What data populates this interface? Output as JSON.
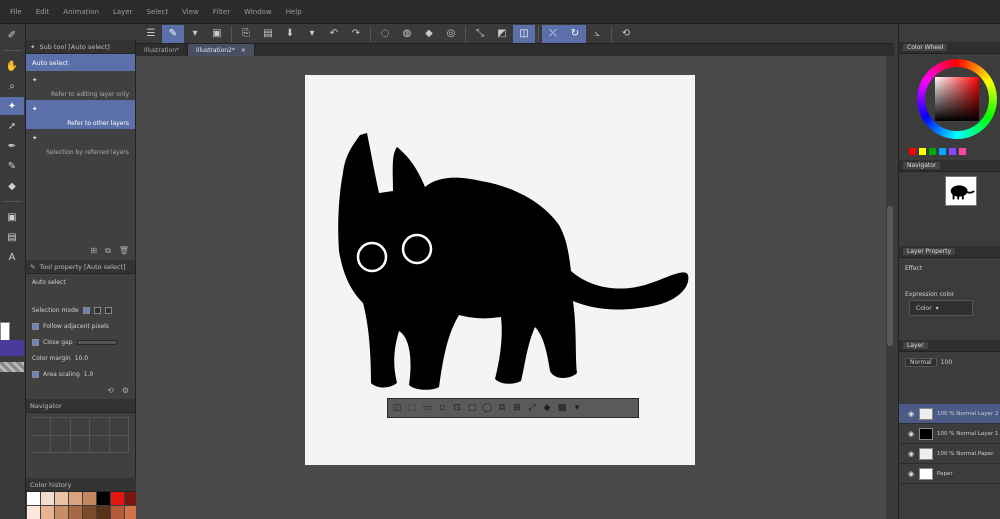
{
  "menu": [
    "File",
    "Edit",
    "Animation",
    "Layer",
    "Select",
    "View",
    "Filter",
    "Window",
    "Help"
  ],
  "command_bar": {
    "icons": [
      "menu-icon",
      "brush-mode-icon",
      "new-icon",
      "open-icon",
      "save-icon",
      "undo-icon",
      "redo-icon",
      "select-all-icon",
      "deselect-icon",
      "fill-icon",
      "transform-icon",
      "flip-icon",
      "ruler-icon",
      "layer-icon",
      "snap-icon",
      "grid-icon",
      "perspective-icon",
      "rotate-icon"
    ]
  },
  "tools": {
    "items": [
      "pen-icon",
      "hand-icon",
      "zoom-icon",
      "auto-select-icon",
      "move-icon",
      "brush-icon",
      "eraser-icon",
      "figure-icon",
      "text-icon"
    ],
    "active_index": 3
  },
  "left_panel": {
    "sub_tool_title": "Sub tool [Auto select]",
    "sub_tools": [
      {
        "label": "Auto select",
        "selected": true
      },
      {
        "label": "Refer to editing layer only",
        "selected": false
      },
      {
        "label": "Refer to other layers",
        "selected": true
      },
      {
        "label": "Selection by referred layers",
        "selected": false
      }
    ],
    "tool_property_title": "Tool property [Auto select]",
    "tool_property_subtitle": "Auto select",
    "properties": [
      {
        "label": "Selection mode",
        "checked": null
      },
      {
        "label": "Follow adjacent pixels",
        "checked": true
      },
      {
        "label": "Close gap",
        "checked": true
      },
      {
        "label": "Color margin",
        "value": "10.0"
      },
      {
        "label": "Area scaling",
        "checked": true,
        "value": "1.0"
      }
    ],
    "navigator_title": "Navigator",
    "color_history_title": "Color history",
    "swatch_colors": [
      "#ffffff",
      "#f1ddd0",
      "#e8c3a6",
      "#d8a47f",
      "#c4885e",
      "#000000",
      "#e0160f",
      "#7a1610",
      "#fde7dc",
      "#e9b291",
      "#c98d66",
      "#a56a45",
      "#7d4a2b",
      "#5a3219",
      "#b55b3a",
      "#d4734a"
    ]
  },
  "tabs": [
    {
      "label": "Illustration*",
      "active": false
    },
    {
      "label": "Illustration2*",
      "active": true
    }
  ],
  "canvas": {
    "paper_color": "#f4f4f4",
    "subject": "black-cat-illustration"
  },
  "selection_launcher": {
    "icons": [
      "deselect-icon",
      "invert-selection-icon",
      "expand-selection-icon",
      "shrink-selection-icon",
      "crop-icon",
      "clear-outside-icon",
      "clear-icon",
      "copy-paste-icon",
      "new-layer-from-selection-icon",
      "scale-icon",
      "fill-icon",
      "tone-icon",
      "more-icon"
    ]
  },
  "right_panel": {
    "color_wheel_tab": "Color Wheel",
    "color_chip_colors": [
      "#ff0000",
      "#ffff00",
      "#00aa00",
      "#00aaff",
      "#8844ff",
      "#ff44aa"
    ],
    "navigator_tab": "Navigator",
    "layer_property_tab": "Layer Property",
    "effect_label": "Effect",
    "expression_label": "Expression color",
    "expression_value": "Color",
    "layer_tab": "Layer",
    "blend_mode": "Normal",
    "opacity": "100",
    "layers": [
      {
        "name": "100 % Normal Layer 2",
        "selected": true
      },
      {
        "name": "100 % Normal Layer 1",
        "selected": false
      },
      {
        "name": "100 % Normal Paper",
        "selected": false
      },
      {
        "name": "Paper",
        "selected": false
      }
    ]
  }
}
